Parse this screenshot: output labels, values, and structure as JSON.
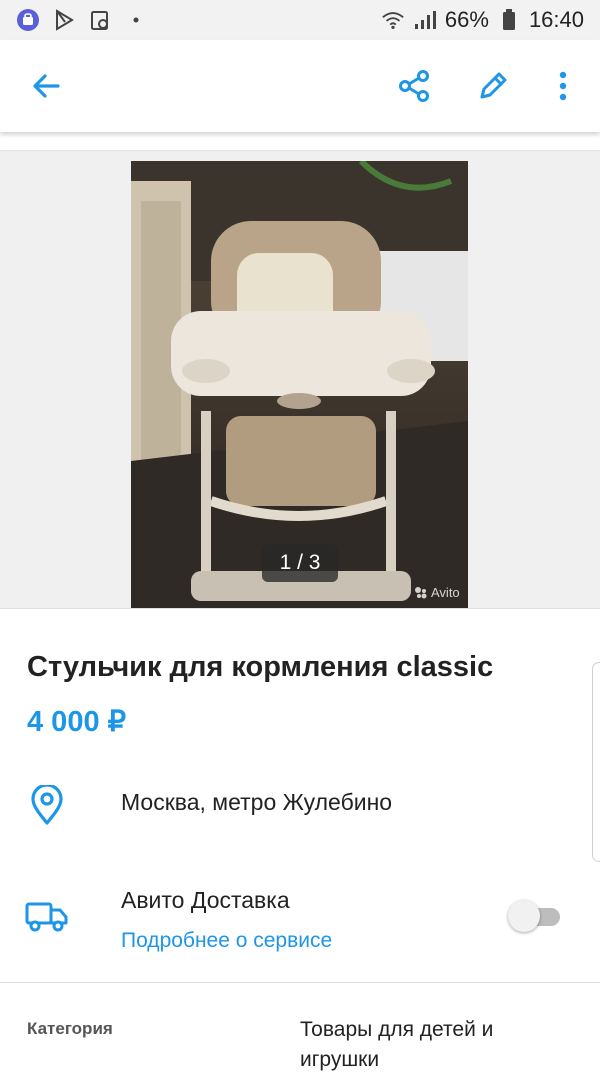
{
  "status_bar": {
    "battery": "66%",
    "time": "16:40",
    "icons": [
      "messenger-icon",
      "play-store-icon",
      "calendar-icon",
      "notification-dot",
      "wifi-icon",
      "signal-icon",
      "battery-icon"
    ]
  },
  "toolbar": {
    "icons": [
      "back-arrow-icon",
      "share-icon",
      "edit-pencil-icon",
      "more-vertical-icon"
    ],
    "accent": "#1e96e8"
  },
  "gallery": {
    "counter": "1 / 3",
    "watermark": "Avito"
  },
  "listing": {
    "title": "Стульчик для кормления classic",
    "price": "4 000 ₽",
    "location": "Москва, метро Жулебино",
    "delivery_title": "Авито Доставка",
    "delivery_link": "Подробнее о сервисе",
    "delivery_enabled": false,
    "category_label": "Категория",
    "category_value": "Товары для детей и игрушки"
  },
  "colors": {
    "accent": "#1e96e8",
    "text": "#222222",
    "toggle_track": "#bdbdbd"
  }
}
